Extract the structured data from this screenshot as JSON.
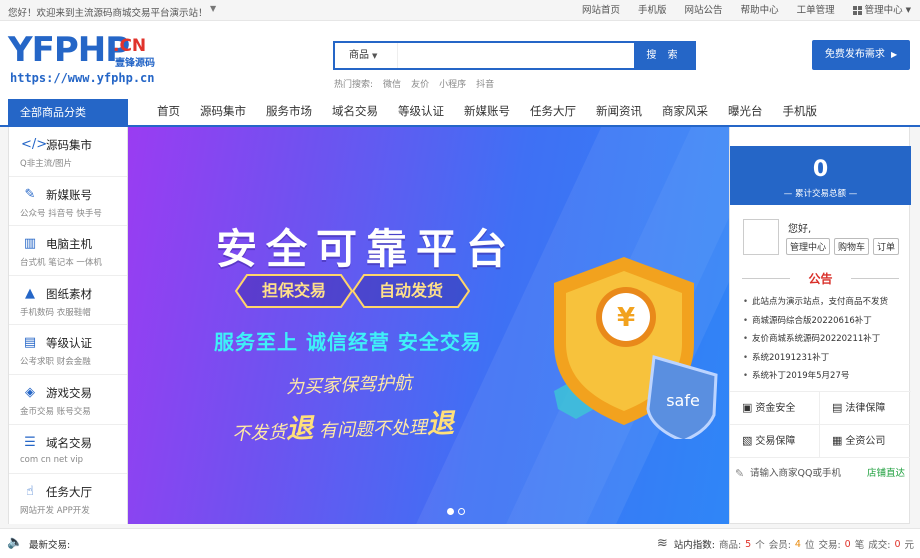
{
  "topbar": {
    "welcome": "您好！欢迎来到主流源码商城交易平台演示站！",
    "links": [
      "网站首页",
      "手机版",
      "网站公告",
      "帮助中心",
      "工单管理"
    ],
    "manage": "管理中心"
  },
  "logo": {
    "main": "YFPHP",
    "cn": ".CN",
    "cn_sub": "壹锋源码",
    "url": "https://www.yfphp.cn"
  },
  "search": {
    "category": "商品",
    "value": "",
    "button": "搜 索",
    "hot_label": "热门搜索:",
    "hot": [
      "微信",
      "友价",
      "小程序",
      "抖音"
    ]
  },
  "publish_button": "免费发布需求",
  "nav": {
    "all_label": "全部商品分类",
    "items": [
      "首页",
      "源码集市",
      "服务市场",
      "域名交易",
      "等级认证",
      "新媒账号",
      "任务大厅",
      "新闻资讯",
      "商家风采",
      "曝光台",
      "手机版"
    ]
  },
  "sidebar": [
    {
      "title": "源码集市",
      "sub": "Q非主流/图片",
      "icon": "code-icon"
    },
    {
      "title": "新媒账号",
      "sub": "公众号  抖音号  快手号",
      "icon": "pencil-icon"
    },
    {
      "title": "电脑主机",
      "sub": "台式机  笔记本  一体机",
      "icon": "chart-icon"
    },
    {
      "title": "图纸素材",
      "sub": "手机数码  衣服鞋帽",
      "icon": "cap-icon"
    },
    {
      "title": "等级认证",
      "sub": "公考求职  财会金融",
      "icon": "cert-icon"
    },
    {
      "title": "游戏交易",
      "sub": "金币交易  账号交易",
      "icon": "gamepad-icon"
    },
    {
      "title": "域名交易",
      "sub": "com  cn  net  vip",
      "icon": "list-icon"
    },
    {
      "title": "任务大厅",
      "sub": "网站开发  APP开发",
      "icon": "thumb-icon"
    }
  ],
  "banner": {
    "title": "安全可靠平台",
    "tags": [
      "担保交易",
      "自动发货"
    ],
    "slogan": "服务至上 诚信经营 安全交易",
    "script_line1": "为买家保驾护航",
    "script_line2_a": "不发货",
    "script_line2_b": "退",
    "script_line2_c": " 有问题不处理",
    "script_line2_d": "退",
    "shield_text": "safe",
    "coin": "¥"
  },
  "right_panel": {
    "total": "0",
    "total_label": "— 累计交易总额 —",
    "hello": "您好,",
    "user_buttons": [
      "管理中心",
      "购物车",
      "订单"
    ],
    "notice_title": "公告",
    "notices": [
      "此站点为演示站点，支付商品不发货",
      "商城源码综合版20220616补丁",
      "友价商城系统源码20220211补丁",
      "系统20191231补丁",
      "系统补丁2019年5月27号"
    ],
    "guarantees": [
      "资金安全",
      "法律保障",
      "交易保障",
      "全资公司"
    ],
    "qq_placeholder": "请输入商家QQ或手机",
    "qq_go": "店铺直达"
  },
  "footer": {
    "latest_label": "最新交易:",
    "index_label": "站内指数:",
    "goods_label": "商品:",
    "goods_value": "5",
    "goods_unit": "个",
    "members_label": "会员:",
    "members_value": "4",
    "members_unit": "位",
    "deals_label": "交易:",
    "deals_value": "0",
    "deals_unit": "笔",
    "volume_label": "成交:",
    "volume_value": "0",
    "volume_unit": "元"
  },
  "colors": {
    "primary": "#2566c7",
    "accent_red": "#e0332b",
    "slogan": "#3ff0f8"
  }
}
